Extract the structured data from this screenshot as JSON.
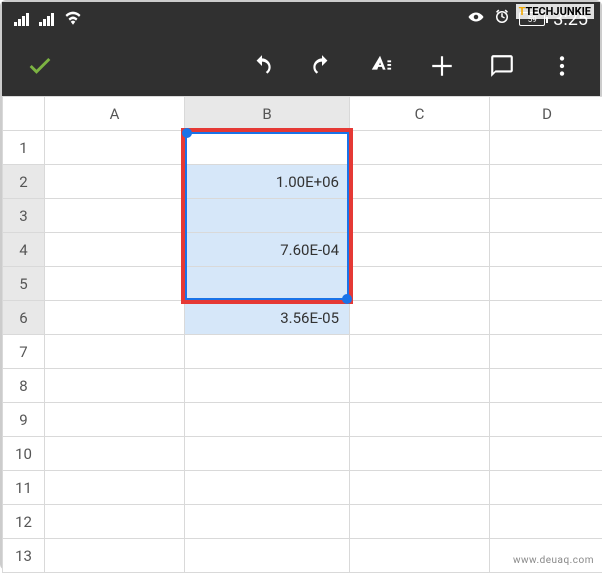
{
  "status": {
    "battery": "59",
    "time": "3:25"
  },
  "columns": [
    "A",
    "B",
    "C",
    "D"
  ],
  "rows": [
    "1",
    "2",
    "3",
    "4",
    "5",
    "6",
    "7",
    "8",
    "9",
    "10",
    "11",
    "12",
    "13"
  ],
  "cells": {
    "b2": "1.00E+06",
    "b4": "7.60E-04",
    "b6": "3.56E-05"
  },
  "watermarks": {
    "techjunkie": "TECHJUNKIE",
    "bottom": "www.deuaq.com"
  }
}
